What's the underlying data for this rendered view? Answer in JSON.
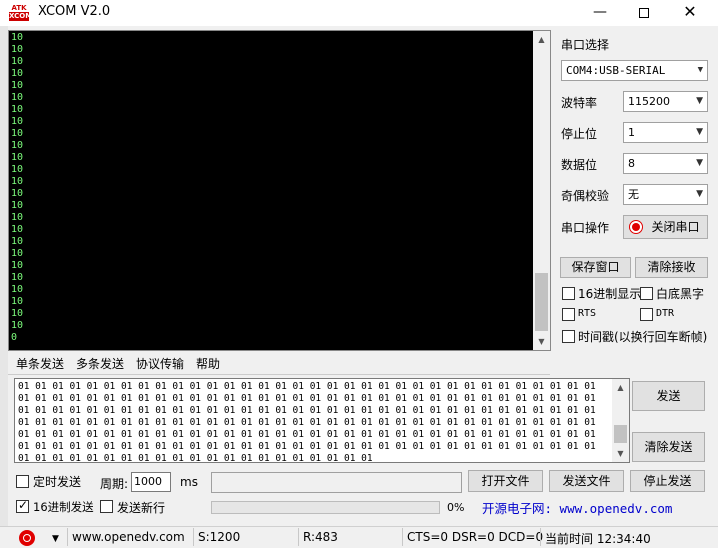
{
  "window": {
    "title": "XCOM V2.0",
    "logo_top": "ATK",
    "logo_bottom": "XCOM"
  },
  "receive": {
    "lines": [
      "10",
      "10",
      "10",
      "10",
      "10",
      "10",
      "10",
      "10",
      "10",
      "10",
      "10",
      "10",
      "10",
      "10",
      "10",
      "10",
      "10",
      "10",
      "10",
      "10",
      "10",
      "10",
      "10",
      "10",
      "10",
      "0"
    ]
  },
  "serial": {
    "section_label": "串口选择",
    "port": "COM4:USB-SERIAL",
    "baud_label": "波特率",
    "baud": "115200",
    "stop_label": "停止位",
    "stop": "1",
    "data_label": "数据位",
    "data": "8",
    "parity_label": "奇偶校验",
    "parity": "无",
    "op_label": "串口操作",
    "op_button": "关闭串口"
  },
  "recv_controls": {
    "save_window": "保存窗口",
    "clear_recv": "清除接收",
    "hex_display": "16进制显示",
    "white_bg": "白底黑字",
    "rts": "RTS",
    "dtr": "DTR",
    "timestamp": "时间戳(以换行回车断帧)"
  },
  "tabs": [
    "单条发送",
    "多条发送",
    "协议传输",
    "帮助"
  ],
  "send": {
    "lines": [
      "01 01 01 01 01 01 01 01 01 01 01 01 01 01 01 01 01 01 01 01 01 01 01 01 01 01 01 01 01 01 01 01 01 01",
      "01 01 01 01 01 01 01 01 01 01 01 01 01 01 01 01 01 01 01 01 01 01 01 01 01 01 01 01 01 01 01 01 01 01",
      "01 01 01 01 01 01 01 01 01 01 01 01 01 01 01 01 01 01 01 01 01 01 01 01 01 01 01 01 01 01 01 01 01 01",
      "01 01 01 01 01 01 01 01 01 01 01 01 01 01 01 01 01 01 01 01 01 01 01 01 01 01 01 01 01 01 01 01 01 01",
      "01 01 01 01 01 01 01 01 01 01 01 01 01 01 01 01 01 01 01 01 01 01 01 01 01 01 01 01 01 01 01 01 01 01",
      "01 01 01 01 01 01 01 01 01 01 01 01 01 01 01 01 01 01 01 01 01 01 01 01 01 01 01 01 01 01 01 01 01 01",
      "01 01 01 01 01 01 01 01 01 01 01 01 01 01 01 01 01 01 01 01 01"
    ],
    "send_button": "发送",
    "clear_button": "清除发送"
  },
  "bottom": {
    "timed_send": "定时发送",
    "period_label": "周期:",
    "period_value": "1000",
    "period_unit": "ms",
    "open_file": "打开文件",
    "send_file": "发送文件",
    "stop_send": "停止发送",
    "hex_send": "16进制发送",
    "send_newline": "发送新行",
    "progress_text": "0%",
    "progress": 0,
    "site_link": "开源电子网: www.openedv.com"
  },
  "statusbar": {
    "url": "www.openedv.com",
    "sent": "S:1200",
    "received": "R:483",
    "lines": "CTS=0 DSR=0 DCD=0",
    "time": "当前时间 12:34:40"
  },
  "colors": {
    "recv_text": "#7cfc7c",
    "site_link": "#0000cc",
    "record": "#e00000"
  }
}
